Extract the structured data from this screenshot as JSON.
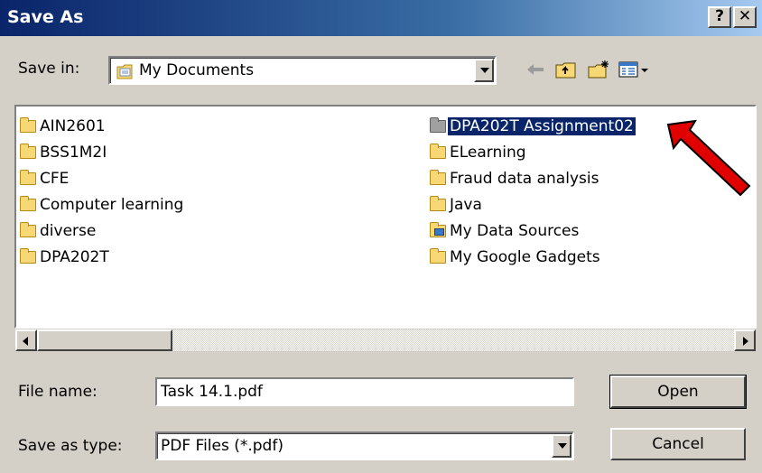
{
  "window": {
    "title": "Save As",
    "help_label": "?",
    "close_label": "✕"
  },
  "toolbar": {
    "save_in_label": "Save in:",
    "location": "My Documents"
  },
  "files": {
    "col1": [
      {
        "name": "AIN2601",
        "icon": "folder-icon"
      },
      {
        "name": "BSS1M2I",
        "icon": "folder-icon"
      },
      {
        "name": "CFE",
        "icon": "folder-icon"
      },
      {
        "name": "Computer learning",
        "icon": "folder-icon"
      },
      {
        "name": "diverse",
        "icon": "folder-icon"
      },
      {
        "name": "DPA202T",
        "icon": "folder-icon"
      }
    ],
    "col2": [
      {
        "name": "DPA202T Assignment02",
        "icon": "folder-icon",
        "selected": true
      },
      {
        "name": "ELearning",
        "icon": "folder-icon"
      },
      {
        "name": "Fraud data analysis",
        "icon": "folder-icon"
      },
      {
        "name": "Java",
        "icon": "folder-icon"
      },
      {
        "name": "My Data Sources",
        "icon": "data-sources-icon"
      },
      {
        "name": "My Google Gadgets",
        "icon": "folder-icon"
      }
    ]
  },
  "form": {
    "file_name_label": "File name:",
    "file_name_value": "Task 14.1.pdf",
    "save_type_label": "Save as type:",
    "save_type_value": "PDF Files (*.pdf)"
  },
  "buttons": {
    "open": "Open",
    "cancel": "Cancel"
  },
  "colors": {
    "title_gradient_start": "#0a246a",
    "selection": "#0a246a",
    "annotation_arrow": "#e00000",
    "dialog_face": "#d4d0c8"
  }
}
